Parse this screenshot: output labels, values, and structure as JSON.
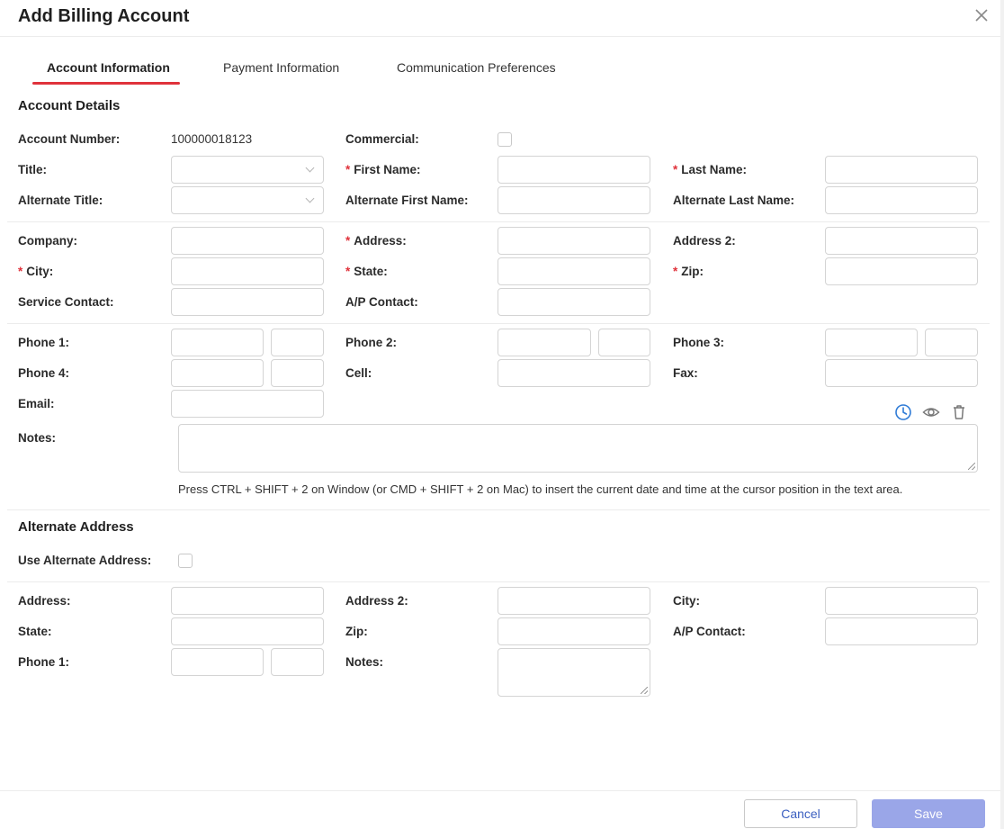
{
  "dialog": {
    "title": "Add Billing Account"
  },
  "tabs": [
    {
      "label": "Account Information",
      "active": true
    },
    {
      "label": "Payment Information",
      "active": false
    },
    {
      "label": "Communication Preferences",
      "active": false
    }
  ],
  "account_details": {
    "heading": "Account Details",
    "account_number_label": "Account Number:",
    "account_number_value": "100000018123",
    "commercial_label": "Commercial:",
    "title_label": "Title:",
    "first_name_label": "First Name:",
    "last_name_label": "Last Name:",
    "alt_title_label": "Alternate Title:",
    "alt_first_name_label": "Alternate First Name:",
    "alt_last_name_label": "Alternate Last Name:",
    "company_label": "Company:",
    "address_label": "Address:",
    "address2_label": "Address 2:",
    "city_label": "City:",
    "state_label": "State:",
    "zip_label": "Zip:",
    "service_contact_label": "Service Contact:",
    "ap_contact_label": "A/P Contact:",
    "phone1_label": "Phone 1:",
    "phone2_label": "Phone 2:",
    "phone3_label": "Phone 3:",
    "phone4_label": "Phone 4:",
    "cell_label": "Cell:",
    "fax_label": "Fax:",
    "email_label": "Email:",
    "notes_label": "Notes:",
    "notes_hint": "Press CTRL + SHIFT + 2 on Window (or CMD + SHIFT + 2 on Mac) to insert the current date and time at the cursor position in the text area.",
    "required_mark": "*"
  },
  "alternate_address": {
    "heading": "Alternate Address",
    "use_alt_label": "Use Alternate Address:",
    "address_label": "Address:",
    "address2_label": "Address 2:",
    "city_label": "City:",
    "state_label": "State:",
    "zip_label": "Zip:",
    "ap_contact_label": "A/P Contact:",
    "phone1_label": "Phone 1:",
    "notes_label": "Notes:"
  },
  "footer": {
    "cancel_label": "Cancel",
    "save_label": "Save"
  },
  "icons": {
    "close": "close-icon",
    "history": "clock-icon",
    "preview": "eye-icon",
    "delete": "trash-icon"
  },
  "colors": {
    "accent": "#e0323b",
    "link": "#3b5fc0",
    "save_disabled": "#9aa6e8",
    "history_icon": "#2f7bd6"
  }
}
